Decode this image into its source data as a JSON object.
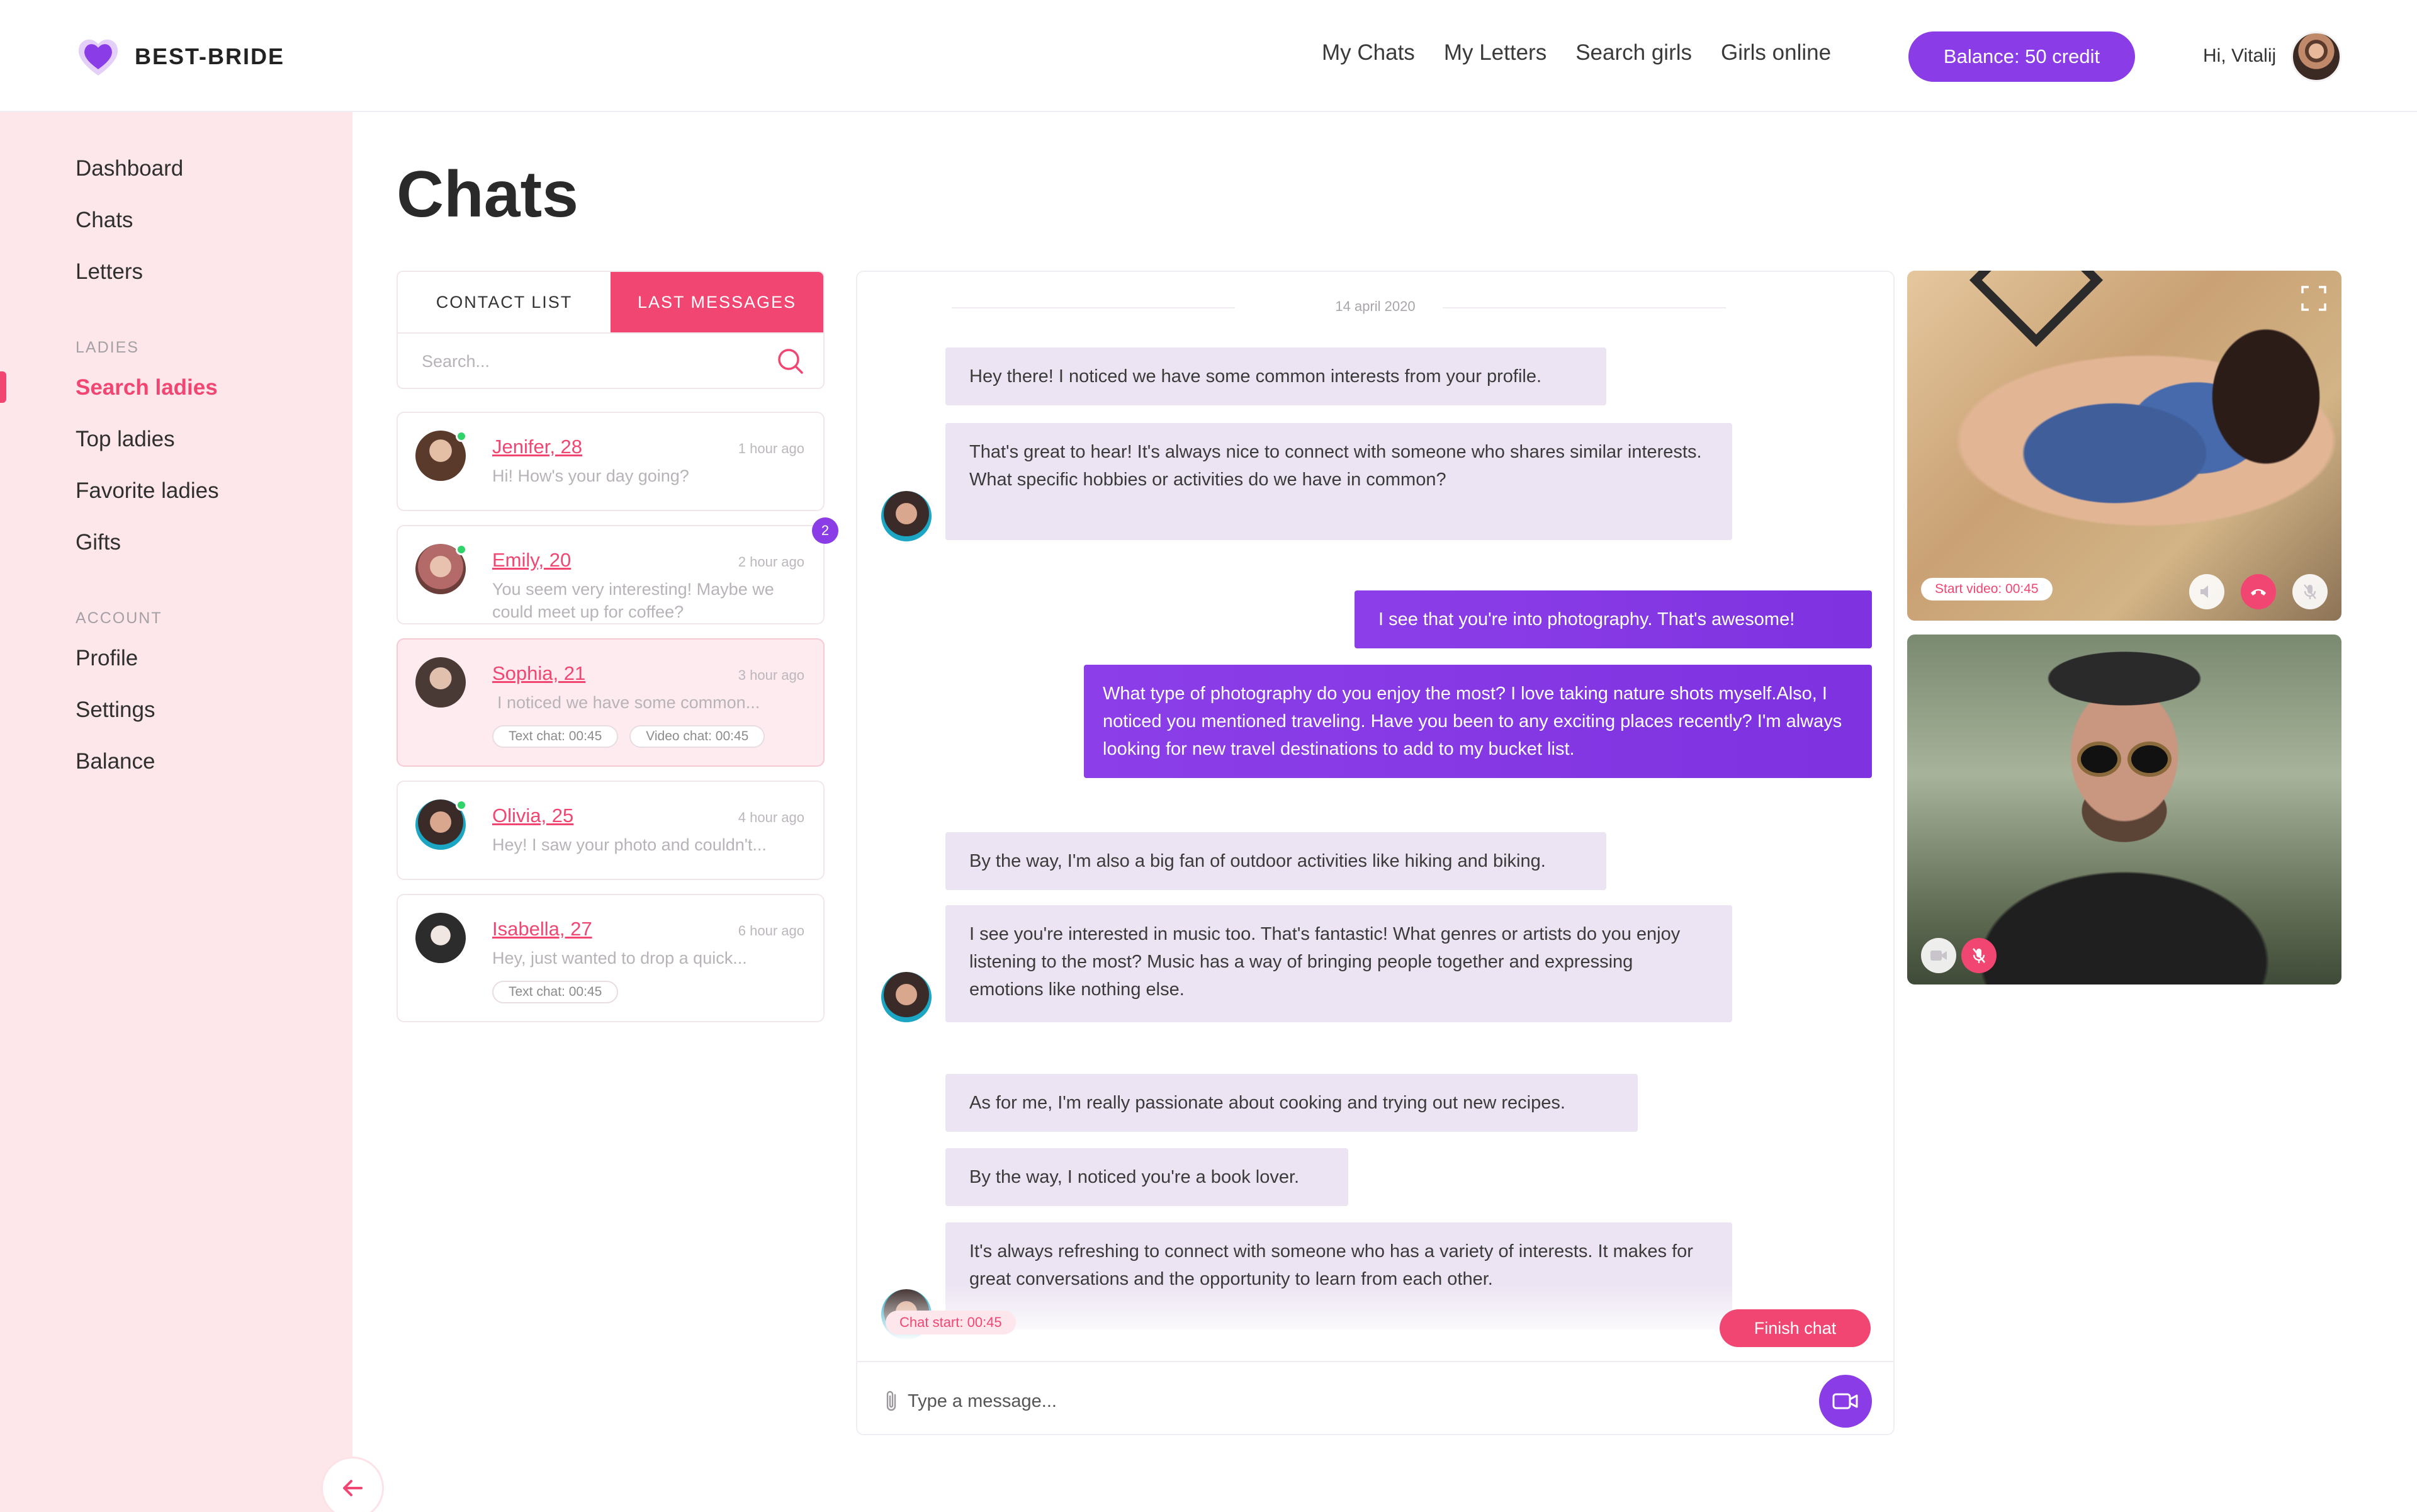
{
  "brand": {
    "name": "BEST-BRIDE",
    "accent": "#8a3ce6",
    "pink": "#f24672"
  },
  "topnav": {
    "items": [
      "My Chats",
      "My Letters",
      "Search girls",
      "Girls online"
    ]
  },
  "balance_label": "Balance: 50 credit",
  "greeting": "Hi, Vitalij",
  "sidebar": {
    "top": [
      "Dashboard",
      "Chats",
      "Letters"
    ],
    "ladies_header": "LADIES",
    "ladies": [
      "Search ladies",
      "Top ladies",
      "Favorite ladies",
      "Gifts"
    ],
    "account_header": "ACCOUNT",
    "account": [
      "Profile",
      "Settings",
      "Balance"
    ]
  },
  "page_title": "Chats",
  "tabs": [
    "CONTACT LIST",
    "LAST MESSAGES"
  ],
  "search_placeholder": "Search...",
  "contacts": [
    {
      "name": "Jenifer, 28",
      "time": "1 hour ago",
      "message": "Hi! How's your day going?",
      "online": true
    },
    {
      "name": "Emily, 20",
      "time": "2 hour ago",
      "message": "You seem very interesting! Maybe we could meet up for coffee?",
      "online": true,
      "unread": "2"
    },
    {
      "name": "Sophia, 21",
      "time": "3 hour ago",
      "message": "I noticed we have some common...",
      "online": false,
      "tags": [
        "Text chat: 00:45",
        "Video chat: 00:45"
      ]
    },
    {
      "name": "Olivia, 25",
      "time": "4 hour ago",
      "message": "Hey! I saw your photo and couldn't...",
      "online": true
    },
    {
      "name": "Isabella, 27",
      "time": "6 hour ago",
      "message": "Hey, just wanted to drop a quick...",
      "online": false,
      "tags": [
        "Text chat: 00:45"
      ]
    }
  ],
  "chat": {
    "date": "14 april 2020",
    "messages": [
      "Hey there! I noticed we have some common interests from your profile.",
      "That's great to hear! It's always nice to connect with someone who shares similar interests. What specific hobbies or activities do we have in common?",
      "I see that you're into photography. That's awesome!",
      "What type of photography do you enjoy the most? I love taking nature shots myself.Also, I noticed you mentioned traveling. Have you been to any exciting places recently? I'm always looking for new travel destinations to add to my bucket list.",
      "By the way, I'm also a big fan of outdoor activities like hiking and biking.",
      "I see you're interested in music too. That's fantastic! What genres or artists do you enjoy listening to the most? Music has a way of bringing people together and expressing emotions like nothing else.",
      "As for me, I'm really passionate about cooking and trying out new recipes.",
      "By the way, I noticed you're a book lover.",
      "It's always refreshing to connect with someone who has a variety of interests. It makes for great conversations and the opportunity to learn from each other."
    ],
    "chat_start": "Chat start: 00:45",
    "finish_label": "Finish chat",
    "input_placeholder": "Type a message..."
  },
  "video": {
    "start_label": "Start video: 00:45"
  }
}
